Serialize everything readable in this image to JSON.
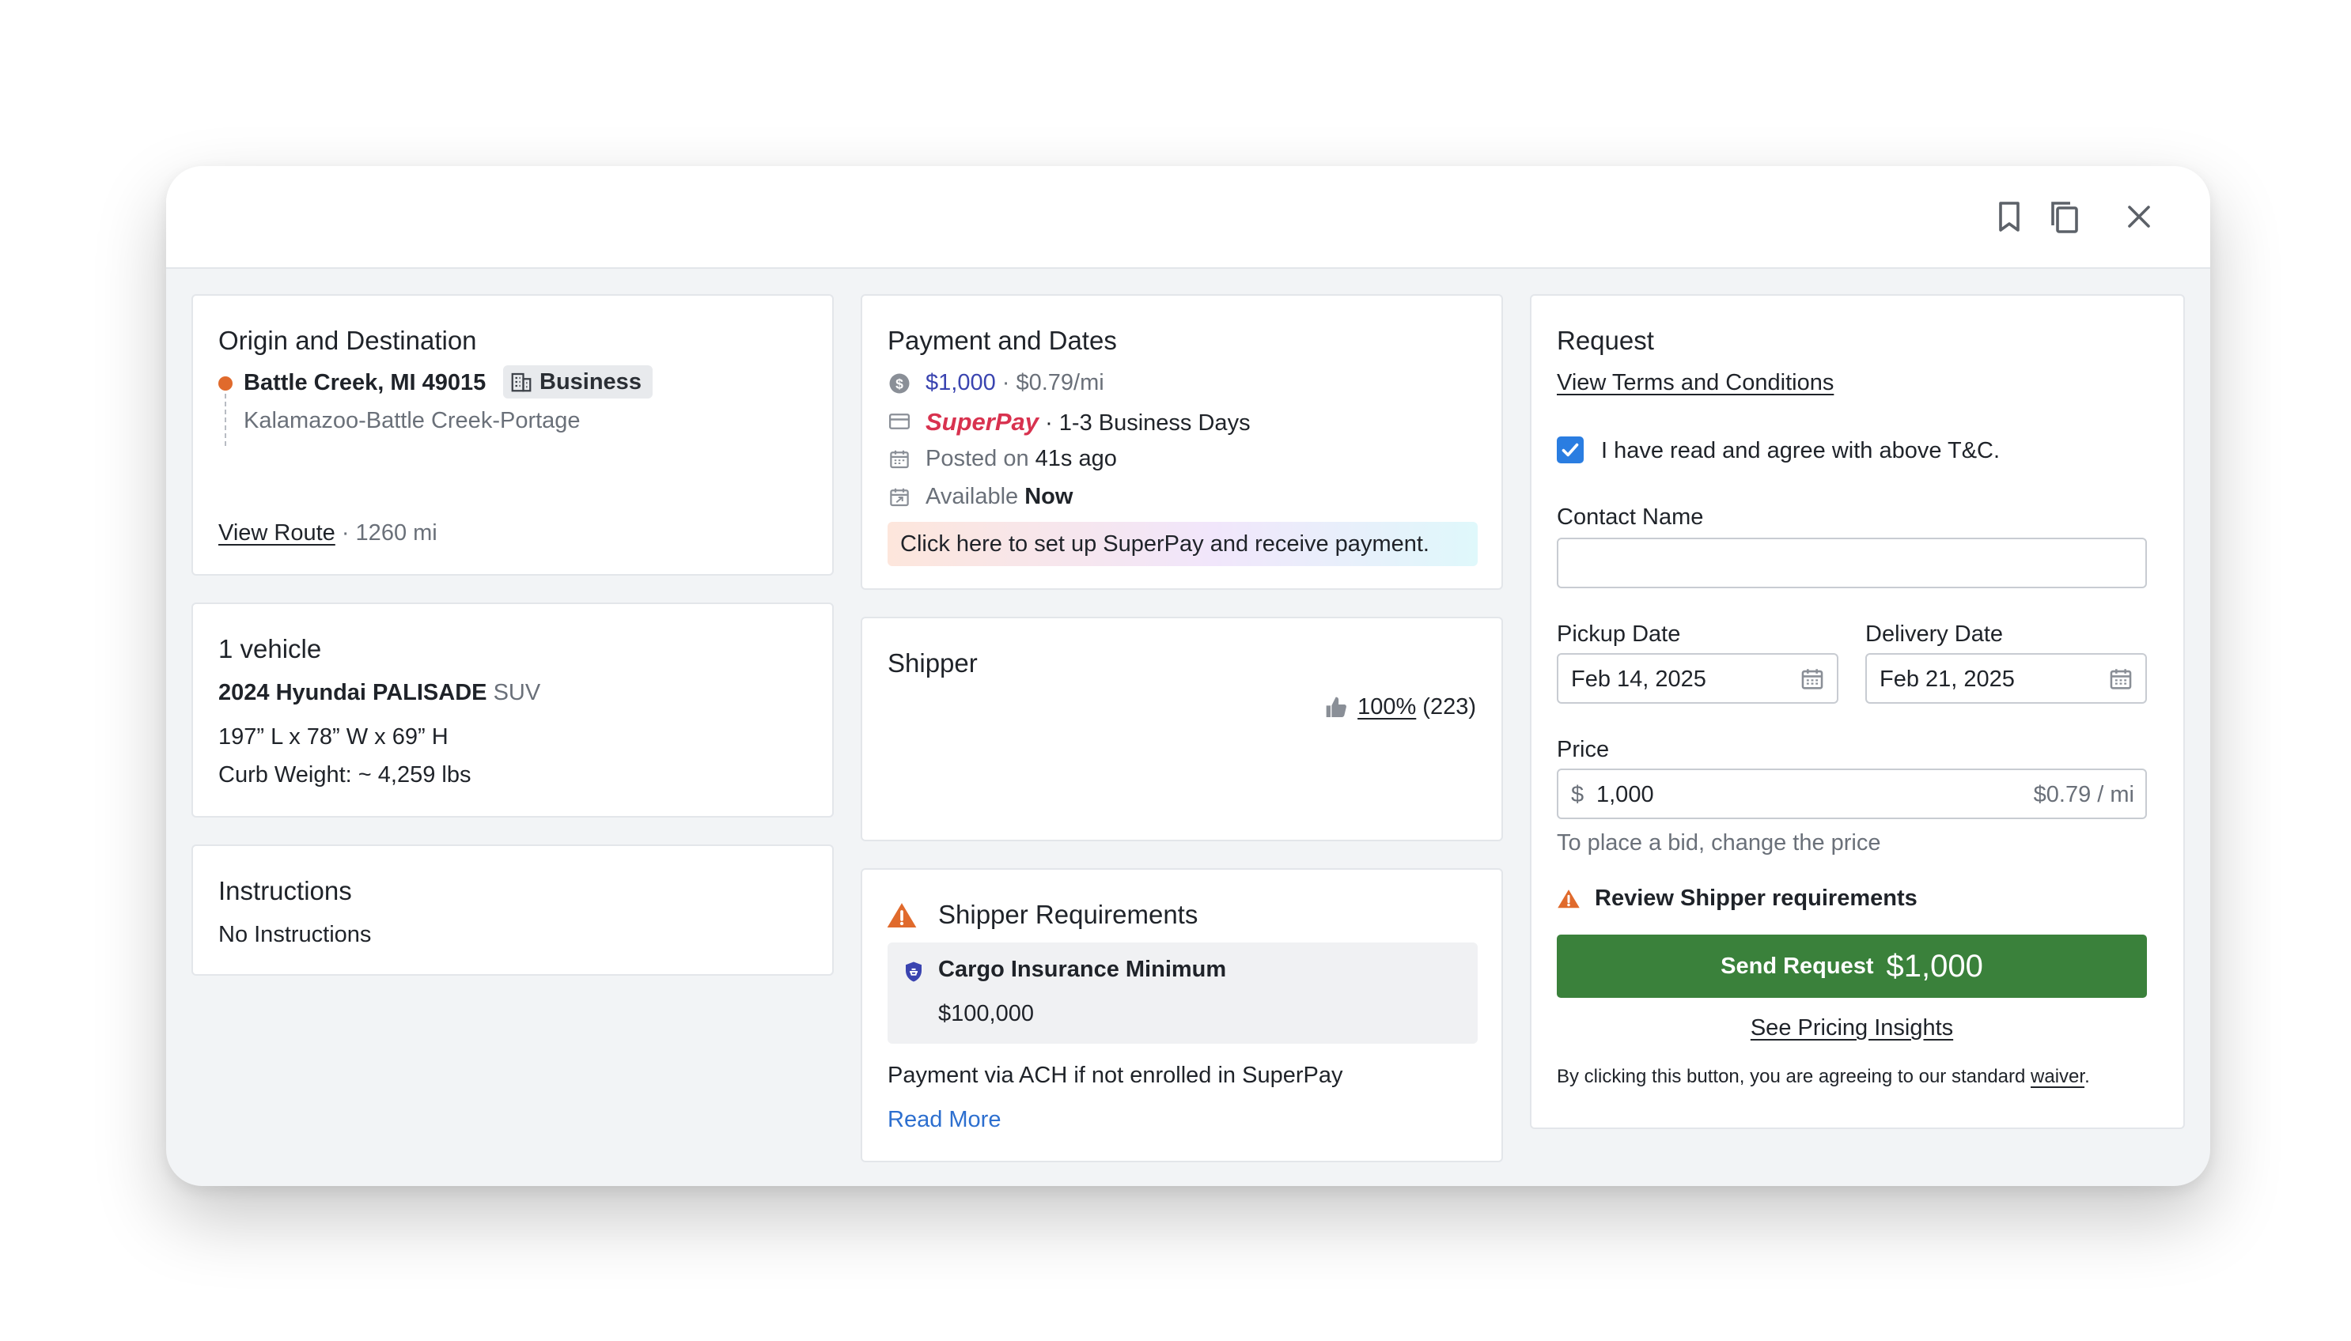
{
  "origin": {
    "title": "Origin and Destination",
    "location": "Battle Creek, MI 49015",
    "badge": "Business",
    "area": "Kalamazoo-Battle Creek-Portage",
    "view_route": "View Route",
    "distance": "· 1260 mi"
  },
  "vehicle": {
    "title": "1 vehicle",
    "name": "2024 Hyundai PALISADE",
    "type": "SUV",
    "dimensions": "197” L x 78” W x 69” H",
    "curb_weight": "Curb Weight: ~ 4,259 lbs"
  },
  "instructions": {
    "title": "Instructions",
    "text": "No Instructions"
  },
  "payment": {
    "title": "Payment and Dates",
    "price": "$1,000",
    "per_mile": "· $0.79/mi",
    "superpay_logo": "SuperPay",
    "terms": "· 1-3 Business Days",
    "posted_prefix": "Posted on",
    "posted_value": "41s ago",
    "available_prefix": "Available",
    "available_value": "Now",
    "banner": "Click here to set up SuperPay and receive payment."
  },
  "shipper": {
    "title": "Shipper",
    "rating": "100%",
    "rating_count": "(223)"
  },
  "requirements": {
    "title": "Shipper Requirements",
    "item_title": "Cargo Insurance Minimum",
    "item_value": "$100,000",
    "note": "Payment via ACH if not enrolled in SuperPay",
    "read_more": "Read More"
  },
  "request": {
    "title": "Request",
    "terms_link": "View Terms and Conditions",
    "agree_label": "I have read and agree with above T&C.",
    "agree_checked": true,
    "contact_label": "Contact Name",
    "contact_value": "",
    "pickup_label": "Pickup Date",
    "pickup_value": "Feb 14, 2025",
    "delivery_label": "Delivery Date",
    "delivery_value": "Feb 21, 2025",
    "price_label": "Price",
    "currency": "$",
    "price_value": "1,000",
    "price_per_mile": "$0.79 / mi",
    "price_hint": "To place a bid, change the price",
    "review_label": "Review Shipper requirements",
    "send_label": "Send Request",
    "send_amount": "$1,000",
    "pricing_insights": "See Pricing Insights",
    "waiver_prefix": "By clicking this button, you are agreeing to our standard",
    "waiver_link": "waiver",
    "waiver_suffix": "."
  },
  "colors": {
    "primary_green": "#3a813b",
    "link_blue": "#2d6fcf",
    "price_blue": "#3a44b0",
    "warning_orange": "#e06a2c",
    "checkbox_blue": "#2a7de1"
  },
  "icons": {
    "header": [
      "bookmark-icon",
      "copy-icon",
      "close-icon"
    ],
    "origin_pin": "location-dot-icon",
    "business": "building-icon",
    "price": "dollar-circle-icon",
    "payment_method": "credit-card-icon",
    "posted": "calendar-icon",
    "available": "calendar-arrow-icon",
    "rating": "thumbs-up-icon",
    "warning": "warning-triangle-icon",
    "insurance": "shield-icon",
    "date_picker": "calendar-icon",
    "checkbox": "check-icon"
  }
}
